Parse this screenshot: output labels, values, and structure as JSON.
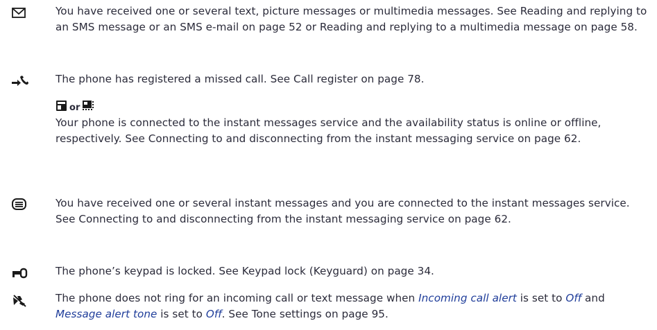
{
  "entries": [
    {
      "icon": "envelope-icon",
      "text": "You have received one or several text, picture messages or multimedia messages. See Reading and replying to an SMS message or an SMS e-mail on page 52 or Reading and replying to a multimedia message on page 58."
    },
    {
      "icon": "missed-call-icon",
      "text": "The phone has registered a missed call. See Call register on page 78."
    },
    {
      "icon_a": "im-online-icon",
      "or": "or",
      "icon_b": "im-offline-icon",
      "text": "Your phone is connected to the instant messages service and the availability status is online or offline, respectively. See Connecting to and disconnecting from the instant messaging service on page 62."
    },
    {
      "icon": "instant-message-icon",
      "text": "You have received one or several instant messages and you are connected to the instant messages service. See Connecting to and disconnecting from the instant messaging service on page 62."
    },
    {
      "icon": "keypad-lock-icon",
      "text": "The phone’s keypad is locked. See Keypad lock (Keyguard) on page 34."
    },
    {
      "icon": "silent-icon",
      "text_1": "The phone does not ring for an incoming call or text message when ",
      "em_1": "Incoming call alert",
      "text_2": " is set to ",
      "em_2": "Off",
      "text_3": " and ",
      "em_3": "Message alert tone",
      "text_4": " is set to ",
      "em_4": "Off",
      "text_5": ". See Tone settings on page 95."
    }
  ],
  "colors": {
    "text": "#2b2b3a",
    "link": "#1f3d9a",
    "icon": "#1a1a1a"
  }
}
